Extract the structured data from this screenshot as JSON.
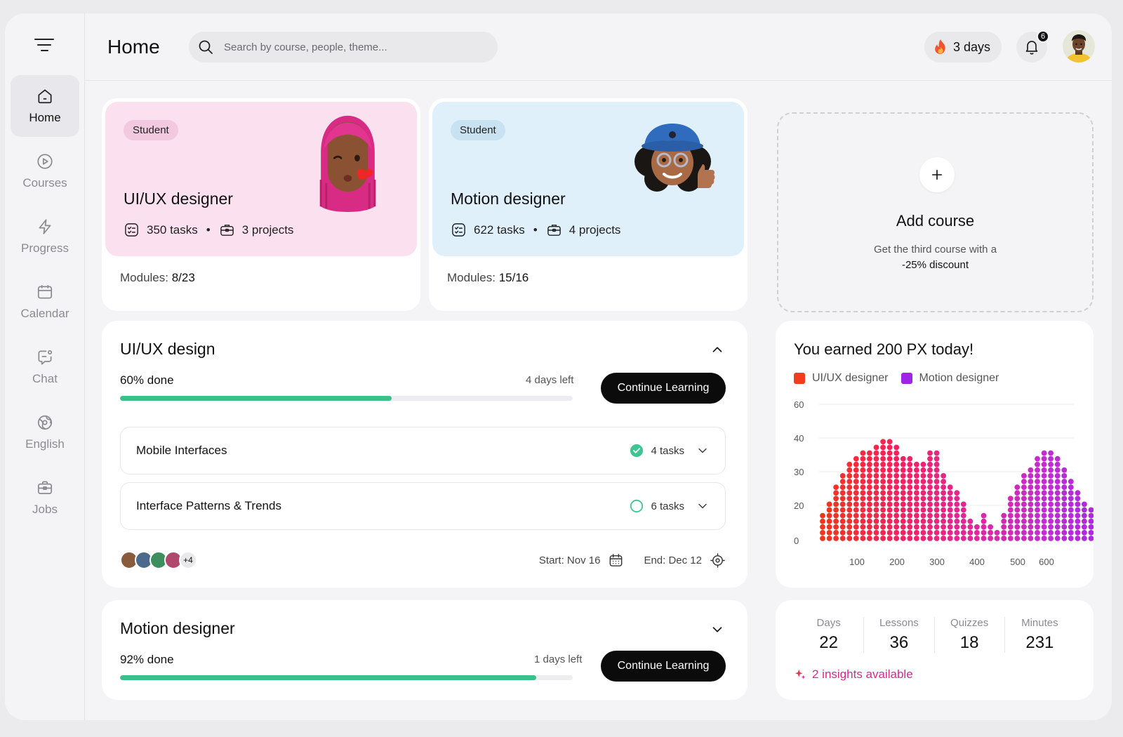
{
  "header": {
    "title": "Home",
    "search_placeholder": "Search by course, people, theme...",
    "streak": "3 days",
    "notifications_count": "6"
  },
  "sidebar": {
    "items": [
      {
        "label": "Home",
        "icon": "home-icon",
        "active": true
      },
      {
        "label": "Courses",
        "icon": "play-circle-icon"
      },
      {
        "label": "Progress",
        "icon": "lightning-icon"
      },
      {
        "label": "Calendar",
        "icon": "calendar-icon"
      },
      {
        "label": "Chat",
        "icon": "chat-icon"
      },
      {
        "label": "English",
        "icon": "globe-icon"
      },
      {
        "label": "Jobs",
        "icon": "briefcase-icon"
      }
    ]
  },
  "courses": [
    {
      "tag": "Student",
      "title": "UI/UX designer",
      "tasks": "350 tasks",
      "projects": "3 projects",
      "modules_label": "Modules:",
      "modules_value": "8/23",
      "bg": "#fbe0ef"
    },
    {
      "tag": "Student",
      "title": "Motion designer",
      "tasks": "622 tasks",
      "projects": "4 projects",
      "modules_label": "Modules:",
      "modules_value": "15/16",
      "bg": "#dff0fb"
    }
  ],
  "add_course": {
    "title": "Add course",
    "line1": "Get the third course with a",
    "line2": "-25% discount"
  },
  "uiux_section": {
    "title": "UI/UX design",
    "done_label": "60% done",
    "progress": 60,
    "days_left": "4 days left",
    "cta": "Continue Learning",
    "lessons": [
      {
        "title": "Mobile Interfaces",
        "tasks": "4 tasks",
        "status": "complete"
      },
      {
        "title": "Interface Patterns & Trends",
        "tasks": "6 tasks",
        "status": "in-progress"
      }
    ],
    "participants_more": "+4",
    "start": "Start: Nov 16",
    "end": "End: Dec 12"
  },
  "motion_section": {
    "title": "Motion designer",
    "done_label": "92% done",
    "progress": 92,
    "days_left": "1 days left",
    "cta": "Continue Learning"
  },
  "earnings": {
    "title": "You earned 200 PX today!",
    "legend": [
      {
        "name": "UI/UX designer",
        "color": "#f23c1f"
      },
      {
        "name": "Motion designer",
        "color": "#a024e8"
      }
    ]
  },
  "stats": {
    "items": [
      {
        "label": "Days",
        "value": "22"
      },
      {
        "label": "Lessons",
        "value": "36"
      },
      {
        "label": "Quizzes",
        "value": "18"
      },
      {
        "label": "Minutes",
        "value": "231"
      }
    ],
    "insights": "2 insights available"
  },
  "chart_data": {
    "type": "bar",
    "style": "dot-columns",
    "y_ticks": [
      0,
      20,
      30,
      40,
      60
    ],
    "x_ticks": [
      100,
      200,
      300,
      400,
      500,
      600
    ],
    "series": [
      {
        "name": "UI/UX designer",
        "color": "#f23c1f"
      },
      {
        "name": "Motion designer",
        "color": "#a024e8"
      }
    ],
    "column_heights": [
      5,
      7,
      10,
      12,
      14,
      15,
      16,
      16,
      17,
      18,
      18,
      17,
      15,
      15,
      14,
      14,
      16,
      16,
      12,
      10,
      9,
      7,
      4,
      3,
      5,
      3,
      2,
      5,
      8,
      10,
      12,
      13,
      15,
      16,
      16,
      15,
      13,
      11,
      9,
      7,
      6,
      4,
      3,
      2,
      1,
      1
    ],
    "color_gradient": [
      "#f0361e",
      "#f4215f",
      "#e2269b",
      "#c12cd4",
      "#a024e8"
    ]
  }
}
